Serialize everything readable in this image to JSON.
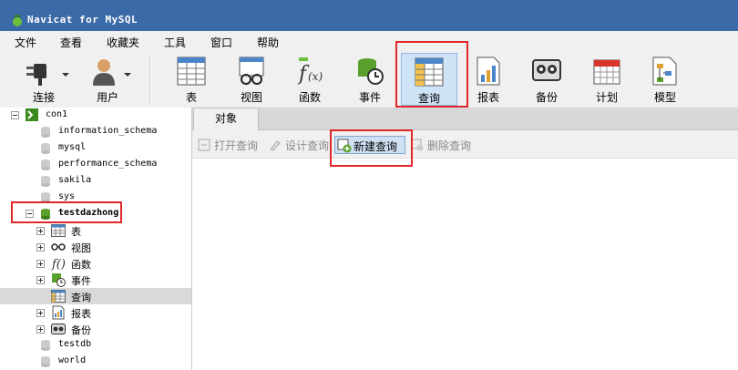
{
  "window": {
    "title": "Navicat for MySQL"
  },
  "menu": {
    "items": [
      "文件",
      "查看",
      "收藏夹",
      "工具",
      "窗口",
      "帮助"
    ]
  },
  "toolbar": {
    "connect": "连接",
    "user": "用户",
    "table": "表",
    "view": "视图",
    "function": "函数",
    "event": "事件",
    "query": "查询",
    "report": "报表",
    "backup": "备份",
    "schedule": "计划",
    "model": "模型"
  },
  "tree": {
    "connection": "con1",
    "databases": [
      "information_schema",
      "mysql",
      "performance_schema",
      "sakila",
      "sys"
    ],
    "active_db": "testdazhong",
    "children": [
      "表",
      "视图",
      "函数",
      "事件",
      "查询",
      "报表",
      "备份"
    ],
    "databases_after": [
      "testdb",
      "world"
    ]
  },
  "objects_tab": {
    "label": "对象"
  },
  "object_toolbar": {
    "open": "打开查询",
    "design": "设计查询",
    "new": "新建查询",
    "delete": "删除查询"
  },
  "colors": {
    "titlebar": "#3b6aa8",
    "highlight": "#e0282a",
    "selected": "#d9d9d9"
  }
}
